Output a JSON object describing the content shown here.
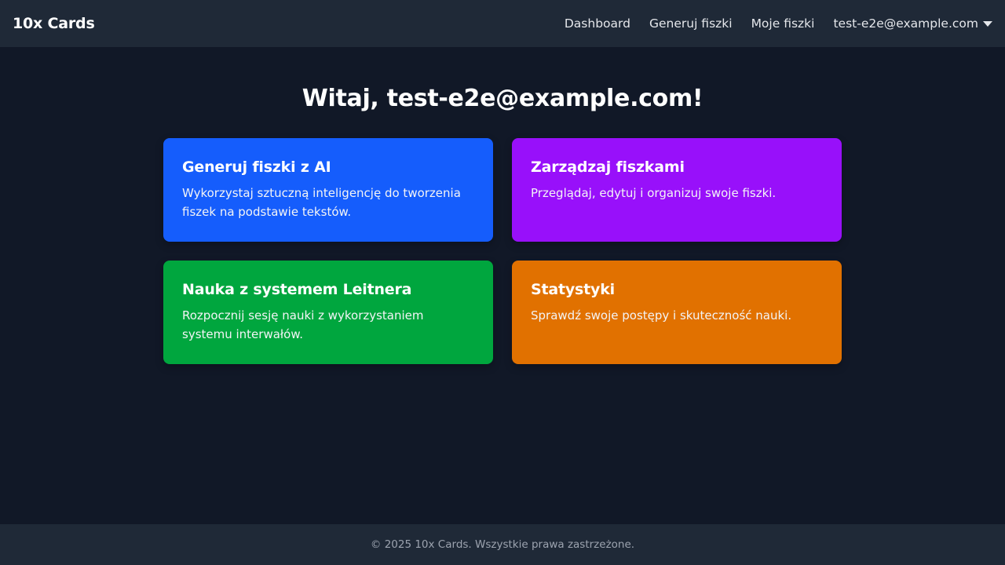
{
  "navbar": {
    "brand": "10x Cards",
    "links": [
      {
        "label": "Dashboard"
      },
      {
        "label": "Generuj fiszki"
      },
      {
        "label": "Moje fiszki"
      }
    ],
    "user_email": "test-e2e@example.com",
    "user_menu_icon": "caret-down-icon"
  },
  "main": {
    "welcome": "Witaj, test-e2e@example.com!",
    "cards": [
      {
        "title": "Generuj fiszki z AI",
        "description": "Wykorzystaj sztuczną inteligencję do tworzenia fiszek na podstawie tekstów.",
        "color": "#155dfc"
      },
      {
        "title": "Zarządzaj fiszkami",
        "description": "Przeglądaj, edytuj i organizuj swoje fiszki.",
        "color": "#9810fa"
      },
      {
        "title": "Nauka z systemem Leitnera",
        "description": "Rozpocznij sesję nauki z wykorzystaniem systemu interwałów.",
        "color": "#00a63e"
      },
      {
        "title": "Statystyki",
        "description": "Sprawdź swoje postępy i skuteczność nauki.",
        "color": "#e17100"
      }
    ]
  },
  "footer": {
    "text": "© 2025 10x Cards. Wszystkie prawa zastrzeżone."
  },
  "colors": {
    "background": "#111827",
    "navbar_bg": "#1f2937",
    "footer_bg": "#1f2937"
  }
}
